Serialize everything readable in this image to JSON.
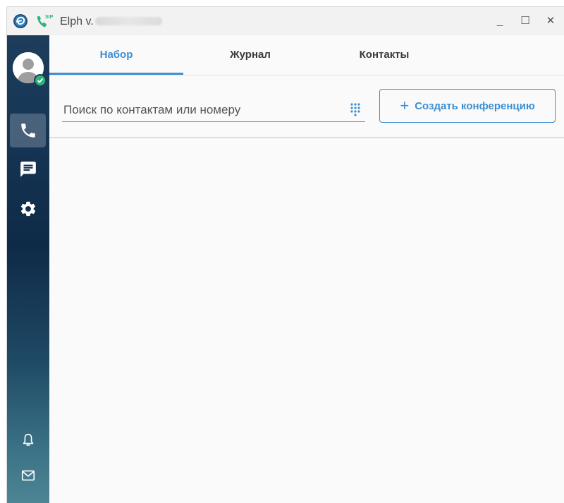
{
  "window": {
    "title": "Elph v.",
    "controls": {
      "minimize": "_",
      "maximize": "☐",
      "close": "✕"
    }
  },
  "sidebar": {
    "top_items": [
      {
        "icon": "phone-icon",
        "active": true
      },
      {
        "icon": "chat-icon",
        "active": false
      },
      {
        "icon": "gear-icon",
        "active": false
      }
    ],
    "bottom_items": [
      {
        "icon": "bell-icon"
      },
      {
        "icon": "mail-icon"
      },
      {
        "icon": "logout-icon"
      }
    ],
    "user_status": "online"
  },
  "tabs": [
    {
      "label": "Набор",
      "active": true
    },
    {
      "label": "Журнал",
      "active": false
    },
    {
      "label": "Контакты",
      "active": false
    }
  ],
  "search": {
    "placeholder": "Поиск по контактам или номеру",
    "value": ""
  },
  "conference_button": {
    "label": "Создать конференцию",
    "icon": "plus-icon"
  },
  "colors": {
    "accent": "#3b8fd3",
    "sidebar_top": "#1e3d5c",
    "sidebar_bottom": "#4d8595",
    "status_online": "#2fb37a"
  }
}
